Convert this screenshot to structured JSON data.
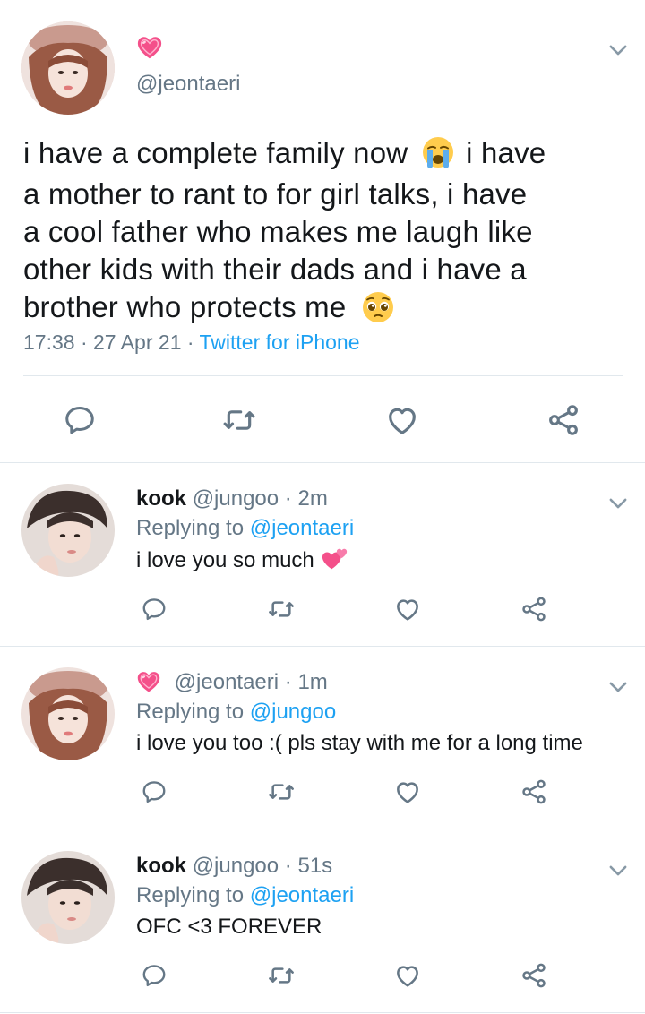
{
  "main_tweet": {
    "handle": "@jeontaeri",
    "body_line_1": "i have a complete family now",
    "body_line_1b": "i have",
    "body_line_2": "a mother to rant to for girl talks, i have",
    "body_line_3": "a cool father who makes me laugh like",
    "body_line_4": "other kids with their dads and i have a",
    "body_line_5": "brother who protects me",
    "time": "17:38",
    "date": "27 Apr 21",
    "source": "Twitter for iPhone",
    "sep": "·"
  },
  "replies": [
    {
      "name": "kook",
      "handle": "@jungoo",
      "time": "2m",
      "replying_prefix": "Replying to",
      "replying_to": "@jeontaeri",
      "text": "i love you so much"
    },
    {
      "name": "",
      "handle": "@jeontaeri",
      "time": "1m",
      "replying_prefix": "Replying to",
      "replying_to": "@jungoo",
      "text": "i love you too :( pls stay with me for a long time"
    },
    {
      "name": "kook",
      "handle": "@jungoo",
      "time": "51s",
      "replying_prefix": "Replying to",
      "replying_to": "@jeontaeri",
      "text": "OFC <3 FOREVER"
    }
  ],
  "icons": [
    "heart-pink-emoji-icon",
    "crying-emoji-icon",
    "pleading-emoji-icon",
    "two-hearts-emoji-icon",
    "chevron-down-icon",
    "reply-icon",
    "retweet-icon",
    "like-icon",
    "share-icon"
  ],
  "colors": {
    "link": "#1da1f2",
    "muted": "#657786",
    "icon": "#657786",
    "divider": "#e1e8ed",
    "pink_heart": "#f4508a"
  }
}
